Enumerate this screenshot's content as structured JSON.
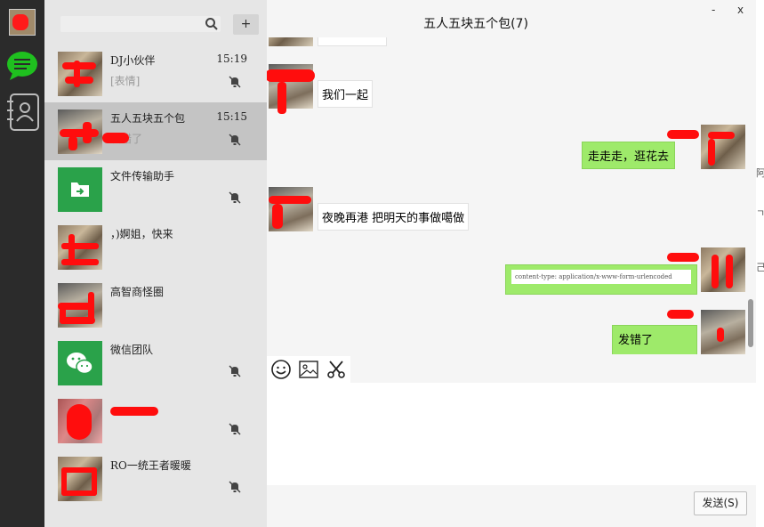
{
  "sidebar": {
    "icons": [
      "avatar",
      "chat-icon",
      "contacts-icon"
    ]
  },
  "search": {
    "placeholder": "",
    "value": ""
  },
  "add_button": "+",
  "sessions": [
    {
      "name": "DJ小伙伴",
      "time": "15:19",
      "preview": "[表情]",
      "muted": true
    },
    {
      "name": "五人五块五个包",
      "time": "15:15",
      "preview": "发错了",
      "muted": true
    },
    {
      "name": "文件传输助手",
      "time": "",
      "preview": "",
      "muted": true
    },
    {
      "name": "，)婀姐，快来",
      "time": "",
      "preview": "",
      "muted": false
    },
    {
      "name": "高智商怪圈",
      "time": "",
      "preview": "",
      "muted": false
    },
    {
      "name": "微信团队",
      "time": "",
      "preview": "",
      "muted": true
    },
    {
      "name": "",
      "time": "",
      "preview": "",
      "muted": true
    },
    {
      "name": "RO一统王者暖暖",
      "time": "",
      "preview": "",
      "muted": true
    }
  ],
  "chat": {
    "title": "五人五块五个包(7)",
    "minimize": "-",
    "close": "x",
    "messages": [
      {
        "side": "left",
        "text": "我们一起"
      },
      {
        "side": "right",
        "text": "走走走，逛花去"
      },
      {
        "side": "left",
        "text": "夜晚再港   把明天的事做噶做"
      },
      {
        "side": "right",
        "text": "content-type: application/x-www-form-urlencoded"
      },
      {
        "side": "right",
        "text": "发错了"
      }
    ],
    "send_label": "发送(S)"
  },
  "right_edge": [
    "阿",
    "ㄱ",
    "己"
  ]
}
